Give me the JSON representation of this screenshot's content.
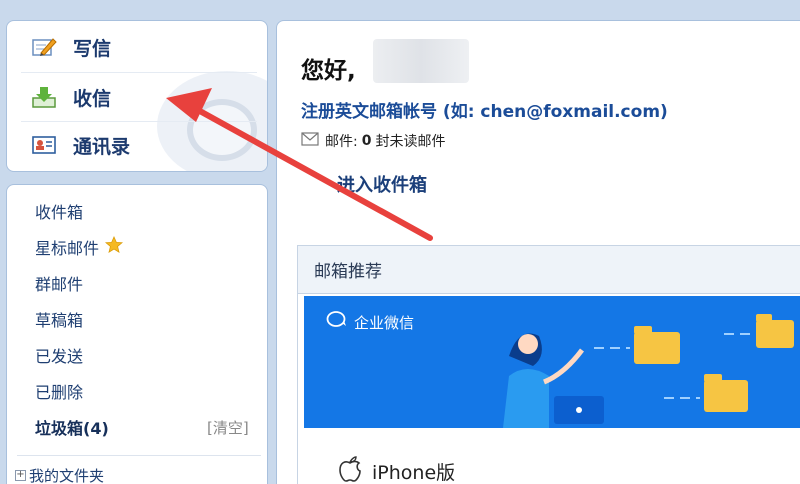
{
  "quick": {
    "compose": "写信",
    "receive": "收信",
    "contacts": "通讯录"
  },
  "folders": {
    "inbox": "收件箱",
    "starred": "星标邮件",
    "group": "群邮件",
    "drafts": "草稿箱",
    "sent": "已发送",
    "deleted": "已删除",
    "spam": "垃圾箱(4)",
    "clear": "[清空]",
    "my_folders": "我的文件夹"
  },
  "main": {
    "greeting": "您好,",
    "register_link": "注册英文邮箱帐号",
    "register_hint": "(如: chen@foxmail.com)",
    "mail_label": "邮件:",
    "unread_count": "0",
    "unread_suffix": "封未读邮件",
    "enter_inbox": "进入收件箱",
    "recommend_title": "邮箱推荐",
    "wework_label": "企业微信",
    "iphone_label": "iPhone版"
  },
  "colors": {
    "accent": "#1b4c98",
    "arrow": "#e8413d",
    "banner": "#1477e6",
    "star": "#f5b921"
  }
}
